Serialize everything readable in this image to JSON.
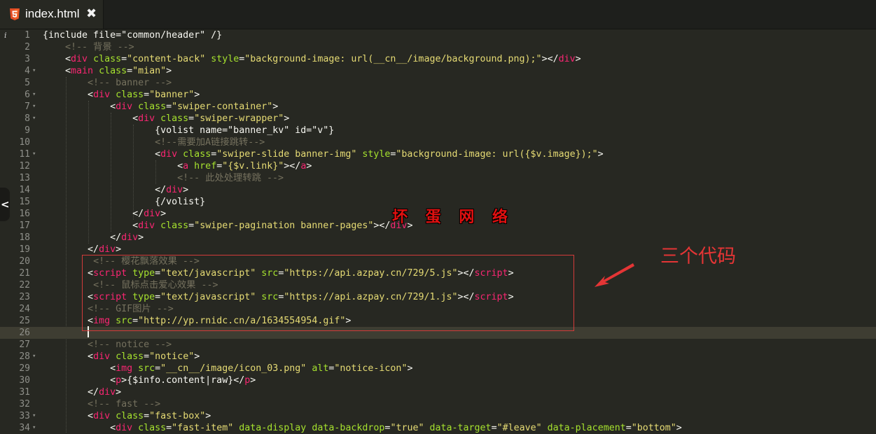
{
  "tab": {
    "icon": "html5-icon",
    "title": "index.html",
    "close_glyph": "✖"
  },
  "gutter": {
    "info_glyph": "i"
  },
  "colors": {
    "background": "#272822",
    "comment": "#75715e",
    "tag": "#f92672",
    "attribute": "#a6e22e",
    "string": "#e6db74",
    "text": "#f8f8f2",
    "annotation": "#e43535"
  },
  "current_line": 26,
  "lines": [
    {
      "n": "1",
      "fold": false,
      "tokens": [
        {
          "t": "c-text",
          "v": "{include file=\"common/header\" /}"
        }
      ]
    },
    {
      "n": "2",
      "fold": false,
      "tokens": [
        {
          "t": "c-text",
          "v": "    "
        },
        {
          "t": "c-comment",
          "v": "<!-- 背景 -->"
        }
      ]
    },
    {
      "n": "3",
      "fold": false,
      "tokens": [
        {
          "t": "c-text",
          "v": "    <"
        },
        {
          "t": "c-tag",
          "v": "div"
        },
        {
          "t": "c-text",
          "v": " "
        },
        {
          "t": "c-attr",
          "v": "class"
        },
        {
          "t": "c-text",
          "v": "="
        },
        {
          "t": "c-str",
          "v": "\"content-back\""
        },
        {
          "t": "c-text",
          "v": " "
        },
        {
          "t": "c-attr",
          "v": "style"
        },
        {
          "t": "c-text",
          "v": "="
        },
        {
          "t": "c-str",
          "v": "\"background-image: url(__cn__/image/background.png);\""
        },
        {
          "t": "c-text",
          "v": "></"
        },
        {
          "t": "c-tag",
          "v": "div"
        },
        {
          "t": "c-text",
          "v": ">"
        }
      ]
    },
    {
      "n": "4",
      "fold": true,
      "tokens": [
        {
          "t": "c-text",
          "v": "    <"
        },
        {
          "t": "c-tag",
          "v": "main"
        },
        {
          "t": "c-text",
          "v": " "
        },
        {
          "t": "c-attr",
          "v": "class"
        },
        {
          "t": "c-text",
          "v": "="
        },
        {
          "t": "c-str",
          "v": "\"mian\""
        },
        {
          "t": "c-text",
          "v": ">"
        }
      ]
    },
    {
      "n": "5",
      "fold": false,
      "tokens": [
        {
          "t": "c-text",
          "v": "        "
        },
        {
          "t": "c-comment",
          "v": "<!-- banner -->"
        }
      ]
    },
    {
      "n": "6",
      "fold": true,
      "tokens": [
        {
          "t": "c-text",
          "v": "        <"
        },
        {
          "t": "c-tag",
          "v": "div"
        },
        {
          "t": "c-text",
          "v": " "
        },
        {
          "t": "c-attr",
          "v": "class"
        },
        {
          "t": "c-text",
          "v": "="
        },
        {
          "t": "c-str",
          "v": "\"banner\""
        },
        {
          "t": "c-text",
          "v": ">"
        }
      ]
    },
    {
      "n": "7",
      "fold": true,
      "tokens": [
        {
          "t": "c-text",
          "v": "            <"
        },
        {
          "t": "c-tag",
          "v": "div"
        },
        {
          "t": "c-text",
          "v": " "
        },
        {
          "t": "c-attr",
          "v": "class"
        },
        {
          "t": "c-text",
          "v": "="
        },
        {
          "t": "c-str",
          "v": "\"swiper-container\""
        },
        {
          "t": "c-text",
          "v": ">"
        }
      ]
    },
    {
      "n": "8",
      "fold": true,
      "tokens": [
        {
          "t": "c-text",
          "v": "                <"
        },
        {
          "t": "c-tag",
          "v": "div"
        },
        {
          "t": "c-text",
          "v": " "
        },
        {
          "t": "c-attr",
          "v": "class"
        },
        {
          "t": "c-text",
          "v": "="
        },
        {
          "t": "c-str",
          "v": "\"swiper-wrapper\""
        },
        {
          "t": "c-text",
          "v": ">"
        }
      ]
    },
    {
      "n": "9",
      "fold": false,
      "tokens": [
        {
          "t": "c-text",
          "v": "                    {volist name=\"banner_kv\" id=\"v\"}"
        }
      ]
    },
    {
      "n": "10",
      "fold": false,
      "tokens": [
        {
          "t": "c-text",
          "v": "                    "
        },
        {
          "t": "c-comment",
          "v": "<!--需要加A链接跳转-->"
        }
      ]
    },
    {
      "n": "11",
      "fold": true,
      "tokens": [
        {
          "t": "c-text",
          "v": "                    <"
        },
        {
          "t": "c-tag",
          "v": "div"
        },
        {
          "t": "c-text",
          "v": " "
        },
        {
          "t": "c-attr",
          "v": "class"
        },
        {
          "t": "c-text",
          "v": "="
        },
        {
          "t": "c-str",
          "v": "\"swiper-slide banner-img\""
        },
        {
          "t": "c-text",
          "v": " "
        },
        {
          "t": "c-attr",
          "v": "style"
        },
        {
          "t": "c-text",
          "v": "="
        },
        {
          "t": "c-str",
          "v": "\"background-image: url({$v.image});\""
        },
        {
          "t": "c-text",
          "v": ">"
        }
      ]
    },
    {
      "n": "12",
      "fold": false,
      "tokens": [
        {
          "t": "c-text",
          "v": "                        <"
        },
        {
          "t": "c-tag",
          "v": "a"
        },
        {
          "t": "c-text",
          "v": " "
        },
        {
          "t": "c-attr",
          "v": "href"
        },
        {
          "t": "c-text",
          "v": "="
        },
        {
          "t": "c-str",
          "v": "\"{$v.link}\""
        },
        {
          "t": "c-text",
          "v": "></"
        },
        {
          "t": "c-tag",
          "v": "a"
        },
        {
          "t": "c-text",
          "v": ">"
        }
      ]
    },
    {
      "n": "13",
      "fold": false,
      "tokens": [
        {
          "t": "c-text",
          "v": "                        "
        },
        {
          "t": "c-comment",
          "v": "<!-- 此处处理转跳 -->"
        }
      ]
    },
    {
      "n": "14",
      "fold": false,
      "tokens": [
        {
          "t": "c-text",
          "v": "                    </"
        },
        {
          "t": "c-tag",
          "v": "div"
        },
        {
          "t": "c-text",
          "v": ">"
        }
      ]
    },
    {
      "n": "15",
      "fold": false,
      "tokens": [
        {
          "t": "c-text",
          "v": "                    {/volist}"
        }
      ]
    },
    {
      "n": "16",
      "fold": false,
      "tokens": [
        {
          "t": "c-text",
          "v": "                </"
        },
        {
          "t": "c-tag",
          "v": "div"
        },
        {
          "t": "c-text",
          "v": ">"
        }
      ]
    },
    {
      "n": "17",
      "fold": false,
      "tokens": [
        {
          "t": "c-text",
          "v": "                <"
        },
        {
          "t": "c-tag",
          "v": "div"
        },
        {
          "t": "c-text",
          "v": " "
        },
        {
          "t": "c-attr",
          "v": "class"
        },
        {
          "t": "c-text",
          "v": "="
        },
        {
          "t": "c-str",
          "v": "\"swiper-pagination banner-pages\""
        },
        {
          "t": "c-text",
          "v": "></"
        },
        {
          "t": "c-tag",
          "v": "div"
        },
        {
          "t": "c-text",
          "v": ">"
        }
      ]
    },
    {
      "n": "18",
      "fold": false,
      "tokens": [
        {
          "t": "c-text",
          "v": "            </"
        },
        {
          "t": "c-tag",
          "v": "div"
        },
        {
          "t": "c-text",
          "v": ">"
        }
      ]
    },
    {
      "n": "19",
      "fold": false,
      "tokens": [
        {
          "t": "c-text",
          "v": "        </"
        },
        {
          "t": "c-tag",
          "v": "div"
        },
        {
          "t": "c-text",
          "v": ">"
        }
      ]
    },
    {
      "n": "20",
      "fold": false,
      "tokens": [
        {
          "t": "c-text",
          "v": "         "
        },
        {
          "t": "c-comment",
          "v": "<!-- 樱花飘落效果 -->"
        }
      ]
    },
    {
      "n": "21",
      "fold": false,
      "tokens": [
        {
          "t": "c-text",
          "v": "        <"
        },
        {
          "t": "c-tag",
          "v": "script"
        },
        {
          "t": "c-text",
          "v": " "
        },
        {
          "t": "c-attr",
          "v": "type"
        },
        {
          "t": "c-text",
          "v": "="
        },
        {
          "t": "c-str",
          "v": "\"text/javascript\""
        },
        {
          "t": "c-text",
          "v": " "
        },
        {
          "t": "c-attr",
          "v": "src"
        },
        {
          "t": "c-text",
          "v": "="
        },
        {
          "t": "c-str",
          "v": "\"https://api.azpay.cn/729/5.js\""
        },
        {
          "t": "c-text",
          "v": "></"
        },
        {
          "t": "c-tag",
          "v": "script"
        },
        {
          "t": "c-text",
          "v": ">"
        }
      ]
    },
    {
      "n": "22",
      "fold": false,
      "tokens": [
        {
          "t": "c-text",
          "v": "         "
        },
        {
          "t": "c-comment",
          "v": "<!-- 鼠标点击爱心效果 -->"
        }
      ]
    },
    {
      "n": "23",
      "fold": false,
      "tokens": [
        {
          "t": "c-text",
          "v": "        <"
        },
        {
          "t": "c-tag",
          "v": "script"
        },
        {
          "t": "c-text",
          "v": " "
        },
        {
          "t": "c-attr",
          "v": "type"
        },
        {
          "t": "c-text",
          "v": "="
        },
        {
          "t": "c-str",
          "v": "\"text/javascript\""
        },
        {
          "t": "c-text",
          "v": " "
        },
        {
          "t": "c-attr",
          "v": "src"
        },
        {
          "t": "c-text",
          "v": "="
        },
        {
          "t": "c-str",
          "v": "\"https://api.azpay.cn/729/1.js\""
        },
        {
          "t": "c-text",
          "v": "></"
        },
        {
          "t": "c-tag",
          "v": "script"
        },
        {
          "t": "c-text",
          "v": ">"
        }
      ]
    },
    {
      "n": "24",
      "fold": false,
      "tokens": [
        {
          "t": "c-text",
          "v": "        "
        },
        {
          "t": "c-comment",
          "v": "<!-- GIF图片 -->"
        }
      ]
    },
    {
      "n": "25",
      "fold": false,
      "tokens": [
        {
          "t": "c-text",
          "v": "        <"
        },
        {
          "t": "c-tag",
          "v": "img"
        },
        {
          "t": "c-text",
          "v": " "
        },
        {
          "t": "c-attr",
          "v": "src"
        },
        {
          "t": "c-text",
          "v": "="
        },
        {
          "t": "c-str",
          "v": "\"http://yp.rnidc.cn/a/1634554954.gif\""
        },
        {
          "t": "c-text",
          "v": ">"
        }
      ]
    },
    {
      "n": "26",
      "fold": false,
      "tokens": [
        {
          "t": "c-text",
          "v": ""
        }
      ]
    },
    {
      "n": "27",
      "fold": false,
      "tokens": [
        {
          "t": "c-text",
          "v": "        "
        },
        {
          "t": "c-comment",
          "v": "<!-- notice -->"
        }
      ]
    },
    {
      "n": "28",
      "fold": true,
      "tokens": [
        {
          "t": "c-text",
          "v": "        <"
        },
        {
          "t": "c-tag",
          "v": "div"
        },
        {
          "t": "c-text",
          "v": " "
        },
        {
          "t": "c-attr",
          "v": "class"
        },
        {
          "t": "c-text",
          "v": "="
        },
        {
          "t": "c-str",
          "v": "\"notice\""
        },
        {
          "t": "c-text",
          "v": ">"
        }
      ]
    },
    {
      "n": "29",
      "fold": false,
      "tokens": [
        {
          "t": "c-text",
          "v": "            <"
        },
        {
          "t": "c-tag",
          "v": "img"
        },
        {
          "t": "c-text",
          "v": " "
        },
        {
          "t": "c-attr",
          "v": "src"
        },
        {
          "t": "c-text",
          "v": "="
        },
        {
          "t": "c-str",
          "v": "\"__cn__/image/icon_03.png\""
        },
        {
          "t": "c-text",
          "v": " "
        },
        {
          "t": "c-attr",
          "v": "alt"
        },
        {
          "t": "c-text",
          "v": "="
        },
        {
          "t": "c-str",
          "v": "\"notice-icon\""
        },
        {
          "t": "c-text",
          "v": ">"
        }
      ]
    },
    {
      "n": "30",
      "fold": false,
      "tokens": [
        {
          "t": "c-text",
          "v": "            <"
        },
        {
          "t": "c-tag",
          "v": "p"
        },
        {
          "t": "c-text",
          "v": ">{$info.content|raw}</"
        },
        {
          "t": "c-tag",
          "v": "p"
        },
        {
          "t": "c-text",
          "v": ">"
        }
      ]
    },
    {
      "n": "31",
      "fold": false,
      "tokens": [
        {
          "t": "c-text",
          "v": "        </"
        },
        {
          "t": "c-tag",
          "v": "div"
        },
        {
          "t": "c-text",
          "v": ">"
        }
      ]
    },
    {
      "n": "32",
      "fold": false,
      "tokens": [
        {
          "t": "c-text",
          "v": "        "
        },
        {
          "t": "c-comment",
          "v": "<!-- fast -->"
        }
      ]
    },
    {
      "n": "33",
      "fold": true,
      "tokens": [
        {
          "t": "c-text",
          "v": "        <"
        },
        {
          "t": "c-tag",
          "v": "div"
        },
        {
          "t": "c-text",
          "v": " "
        },
        {
          "t": "c-attr",
          "v": "class"
        },
        {
          "t": "c-text",
          "v": "="
        },
        {
          "t": "c-str",
          "v": "\"fast-box\""
        },
        {
          "t": "c-text",
          "v": ">"
        }
      ]
    },
    {
      "n": "34",
      "fold": true,
      "tokens": [
        {
          "t": "c-text",
          "v": "            <"
        },
        {
          "t": "c-tag",
          "v": "div"
        },
        {
          "t": "c-text",
          "v": " "
        },
        {
          "t": "c-attr",
          "v": "class"
        },
        {
          "t": "c-text",
          "v": "="
        },
        {
          "t": "c-str",
          "v": "\"fast-item\""
        },
        {
          "t": "c-text",
          "v": " "
        },
        {
          "t": "c-attr",
          "v": "data-display"
        },
        {
          "t": "c-text",
          "v": " "
        },
        {
          "t": "c-attr",
          "v": "data-backdrop"
        },
        {
          "t": "c-text",
          "v": "="
        },
        {
          "t": "c-str",
          "v": "\"true\""
        },
        {
          "t": "c-text",
          "v": " "
        },
        {
          "t": "c-attr",
          "v": "data-target"
        },
        {
          "t": "c-text",
          "v": "="
        },
        {
          "t": "c-str",
          "v": "\"#leave\""
        },
        {
          "t": "c-text",
          "v": " "
        },
        {
          "t": "c-attr",
          "v": "data-placement"
        },
        {
          "t": "c-text",
          "v": "="
        },
        {
          "t": "c-str",
          "v": "\"bottom\""
        },
        {
          "t": "c-text",
          "v": ">"
        }
      ]
    }
  ],
  "overlays": {
    "watermark": "坏 蛋 网 络",
    "annotation": "三个代码",
    "side_handle_glyph": "<"
  }
}
